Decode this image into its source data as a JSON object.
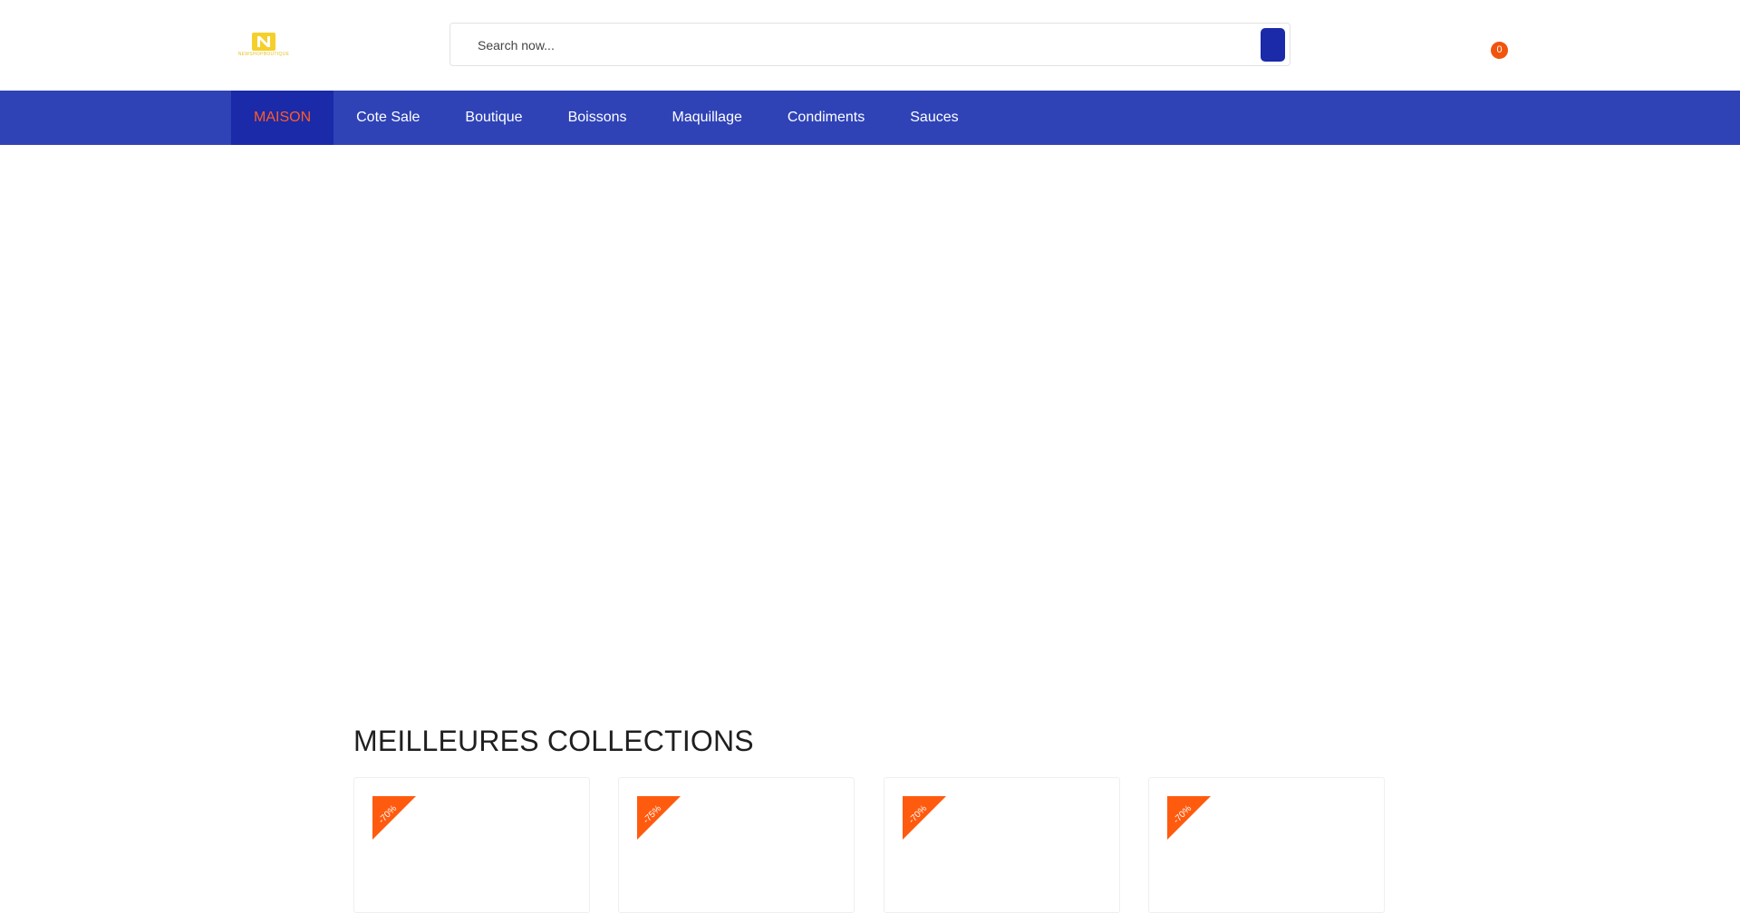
{
  "header": {
    "logo_text": "NEWSHOPBOUTIQUE",
    "logo_letter": "N"
  },
  "search": {
    "placeholder": "Search now..."
  },
  "cart": {
    "count": "0",
    "icon": "cart-icon"
  },
  "nav": {
    "items": [
      {
        "label": "MAISON",
        "active": true
      },
      {
        "label": "Cote Sale"
      },
      {
        "label": "Boutique"
      },
      {
        "label": "Boissons"
      },
      {
        "label": "Maquillage"
      },
      {
        "label": "Condiments"
      },
      {
        "label": "Sauces"
      }
    ]
  },
  "section": {
    "title": "MEILLEURES COLLECTIONS"
  },
  "products": [
    {
      "discount": "-70%"
    },
    {
      "discount": "-75%"
    },
    {
      "discount": "-70%"
    },
    {
      "discount": "-70%"
    }
  ],
  "colors": {
    "nav_bg": "#2f43b7",
    "nav_active_bg": "#1a2aa8",
    "accent": "#ff5b29",
    "badge": "#f0540e",
    "logo_gold": "#e6c229"
  }
}
